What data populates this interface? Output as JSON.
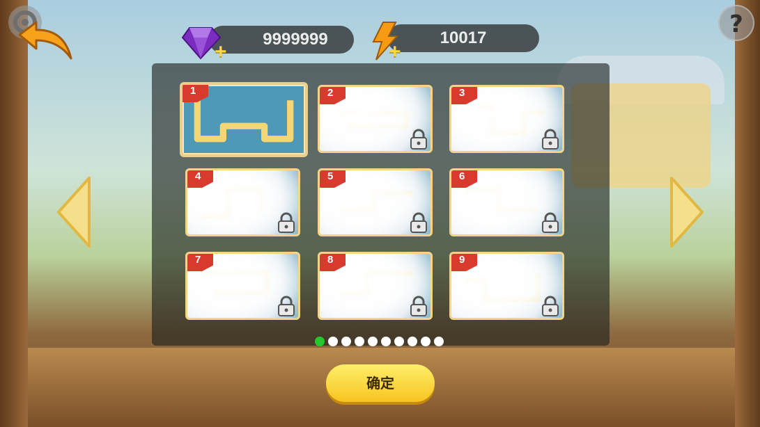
{
  "hud": {
    "gems": "9999999",
    "energy": "10017",
    "plus_symbol": "+"
  },
  "buttons": {
    "help": "?",
    "confirm": "确定"
  },
  "levels": [
    {
      "number": "1",
      "locked": false
    },
    {
      "number": "2",
      "locked": true
    },
    {
      "number": "3",
      "locked": true
    },
    {
      "number": "4",
      "locked": true
    },
    {
      "number": "5",
      "locked": true
    },
    {
      "number": "6",
      "locked": true
    },
    {
      "number": "7",
      "locked": true
    },
    {
      "number": "8",
      "locked": true
    },
    {
      "number": "9",
      "locked": true
    }
  ],
  "pagination": {
    "pages": 10,
    "current": 1
  },
  "colors": {
    "badge": "#d83a2d",
    "confirm_button": "#f7c420",
    "active_dot": "#27c62e",
    "panel": "#1c201e",
    "track": "#f5d675"
  },
  "icons": [
    "gear-icon",
    "back-arrow-icon",
    "help-icon",
    "gem-icon",
    "lightning-icon",
    "lock-icon",
    "arrow-left-icon",
    "arrow-right-icon"
  ]
}
